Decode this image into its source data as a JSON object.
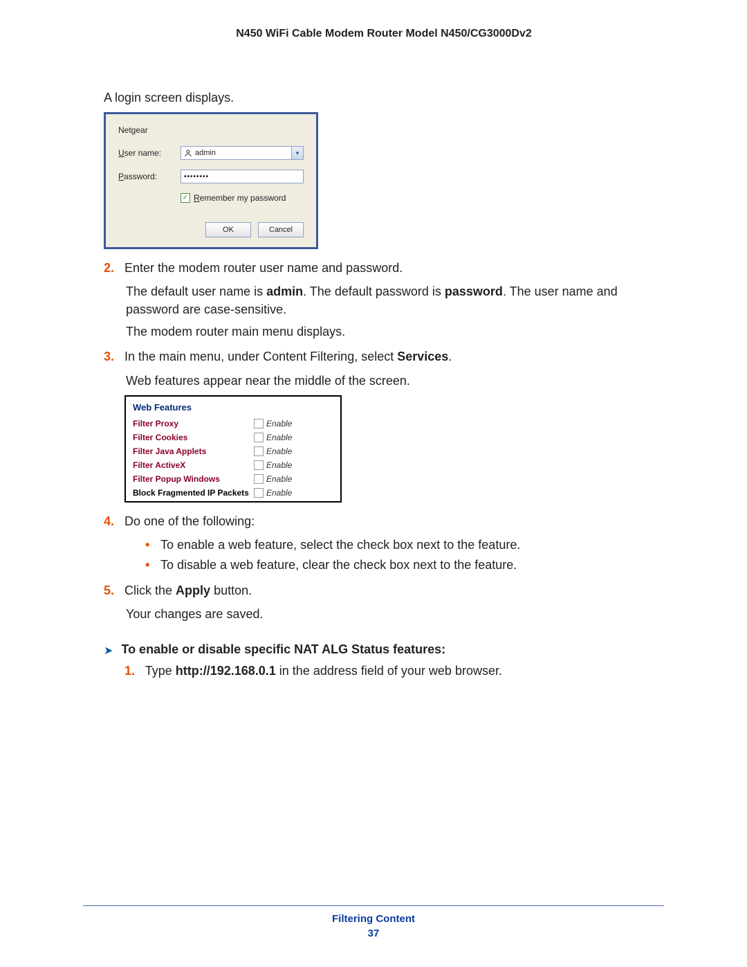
{
  "doc_title": "N450 WiFi Cable Modem Router Model N450/CG3000Dv2",
  "intro_para": "A login screen displays.",
  "login": {
    "brand": "Netgear",
    "username_label_prefix": "U",
    "username_label_rest": "ser name:",
    "username_value": "admin",
    "password_label_prefix": "P",
    "password_label_rest": "assword:",
    "password_mask": "••••••••",
    "remember_prefix": "R",
    "remember_rest": "emember my password",
    "ok": "OK",
    "cancel": "Cancel"
  },
  "step2": {
    "num": "2.",
    "text": "Enter the modem router user name and password.",
    "detail_1a": "The default user name is ",
    "detail_1b": "admin",
    "detail_1c": ". The default password is ",
    "detail_1d": "password",
    "detail_1e": ". The user name and password are case-sensitive.",
    "detail_2": "The modem router main menu displays."
  },
  "step3": {
    "num": "3.",
    "text_a": "In the main menu, under Content Filtering, select ",
    "text_b": "Services",
    "text_c": ".",
    "after": "Web features appear near the middle of the screen."
  },
  "webfeat": {
    "title": "Web Features",
    "rows": [
      {
        "label": "Filter Proxy",
        "enable": "Enable"
      },
      {
        "label": "Filter Cookies",
        "enable": "Enable"
      },
      {
        "label": "Filter Java Applets",
        "enable": "Enable"
      },
      {
        "label": "Filter ActiveX",
        "enable": "Enable"
      },
      {
        "label": "Filter Popup Windows",
        "enable": "Enable"
      },
      {
        "label": "Block Fragmented IP Packets",
        "enable": "Enable"
      }
    ]
  },
  "step4": {
    "num": "4.",
    "text": "Do one of the following:",
    "bullets": [
      "To enable a web feature, select the check box next to the feature.",
      "To disable a web feature, clear the check box next to the feature."
    ]
  },
  "step5": {
    "num": "5.",
    "text_a": "Click the ",
    "text_b": "Apply",
    "text_c": " button.",
    "after": "Your changes are saved."
  },
  "arrow_heading": "To enable or disable specific NAT ALG Status features:",
  "substep1": {
    "num": "1.",
    "text_a": "Type ",
    "text_b": "http://192.168.0.1",
    "text_c": " in the address field of your web browser."
  },
  "footer": {
    "section": "Filtering Content",
    "page": "37"
  }
}
